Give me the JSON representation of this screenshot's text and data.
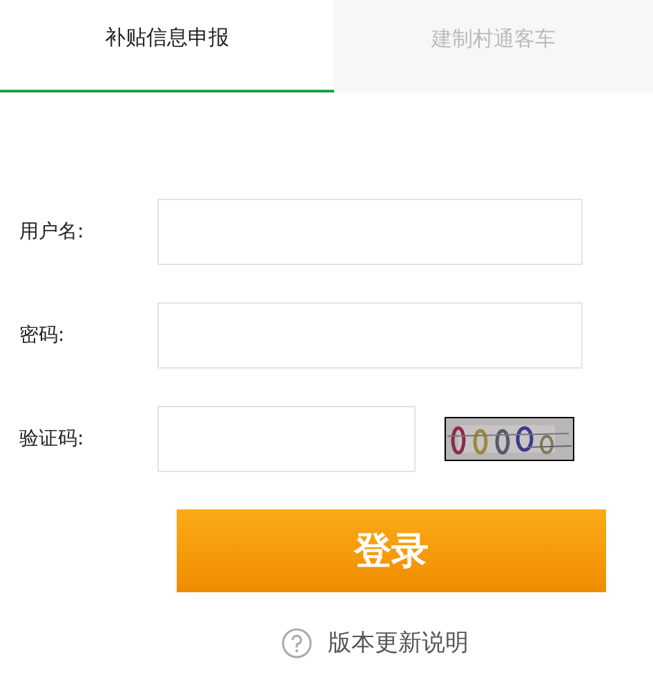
{
  "tabs": [
    {
      "label": "补贴信息申报",
      "selected": true
    },
    {
      "label": "建制村通客车",
      "selected": false
    }
  ],
  "form": {
    "fields": [
      {
        "kind": "text",
        "label": "用户名:"
      },
      {
        "kind": "password",
        "label": "密码:"
      },
      {
        "kind": "captcha",
        "label": "验证码:"
      }
    ],
    "submit": "登录",
    "help_link": "版本更新说明"
  }
}
